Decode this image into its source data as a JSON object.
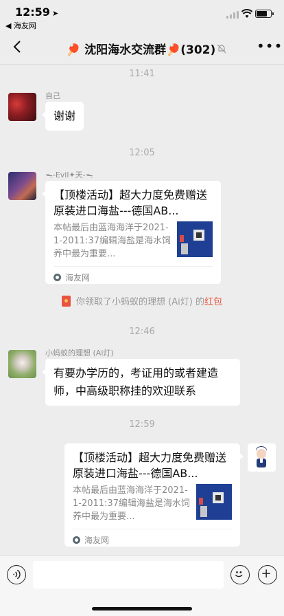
{
  "status_bar": {
    "time": "12:59",
    "back_app": "◀ 海友网",
    "battery_level": 0.8
  },
  "nav": {
    "title": "🏓 沈阳海水交流群🏓(302)",
    "more_label": "•••"
  },
  "messages": [
    {
      "type": "timestamp",
      "text": "11:41"
    },
    {
      "type": "text",
      "sender": "自己",
      "text": "谢谢"
    },
    {
      "type": "timestamp",
      "text": "12:05"
    },
    {
      "type": "link",
      "sender": "ᯓ-Evil✦天-ᯓ",
      "title": "【顶楼活动】超大力度免费赠送原装进口海盐---德国AB...",
      "description": "本帖最后由蓝海海洋于2021-1-2011:37编辑海盐是海水饲养中最为重要...",
      "source": "海友网"
    },
    {
      "type": "system",
      "prefix": "你领取了小蚂蚁的理想 (Ai灯) 的",
      "link": "红包"
    },
    {
      "type": "timestamp",
      "text": "12:46"
    },
    {
      "type": "text",
      "sender": "小蚂蚁的理想 (Ai灯)",
      "text": "有要办学历的，考证用的或者建造师，中高级职称挂的欢迎联系"
    },
    {
      "type": "timestamp",
      "text": "12:59"
    },
    {
      "type": "link",
      "sender": "",
      "title": "【顶楼活动】超大力度免费赠送原装进口海盐---德国AB...",
      "description": "本帖最后由蓝海海洋于2021-1-2011:37编辑海盐是海水饲养中最为重要...",
      "source": "海友网"
    }
  ],
  "input": {
    "value": "",
    "placeholder": ""
  },
  "icons": {
    "back": "chevron-left-icon",
    "mute": "bell-slash-icon",
    "voice": "voice-icon",
    "emoji": "emoji-icon",
    "plus": "plus-icon"
  },
  "colors": {
    "background": "#ededed",
    "red_packet": "#e8543f",
    "bubble": "#ffffff"
  }
}
